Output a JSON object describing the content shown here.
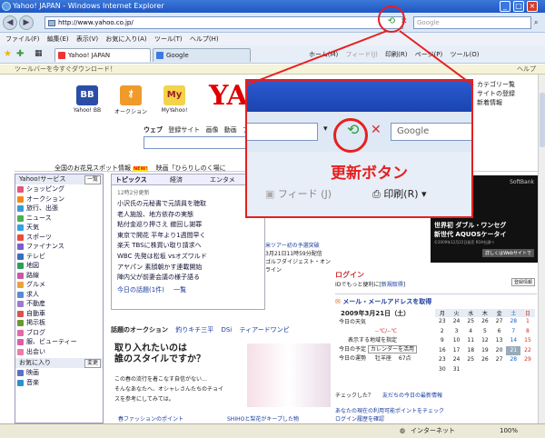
{
  "window": {
    "title": "Yahoo! JAPAN - Windows Internet Explorer"
  },
  "address": {
    "url": "http://www.yahoo.co.jp/",
    "search_placeholder": "Google"
  },
  "menu": [
    "ファイル(F)",
    "編集(E)",
    "表示(V)",
    "お気に入り(A)",
    "ツール(T)",
    "ヘルプ(H)"
  ],
  "tabs": [
    {
      "label": "Yahoo! JAPAN"
    },
    {
      "label": "Google"
    }
  ],
  "cmdbar": {
    "home": "ホーム(M)",
    "feed": "フィード(J)",
    "print": "印刷(R)",
    "page": "ページ(P)",
    "tools": "ツール(O)"
  },
  "infobar": {
    "text": "ツールバーを今すぐダウンロード！",
    "help": "ヘルプ"
  },
  "services": [
    {
      "label": "Yahoo! BB",
      "glyph": "BB"
    },
    {
      "label": "オークション",
      "glyph": "ｵ"
    },
    {
      "label": "MyYahoo!",
      "glyph": "My"
    }
  ],
  "logo": "YAH",
  "toprightlinks": [
    "カテゴリー覧",
    "サイトの登録",
    "新着情報"
  ],
  "searchtabs": [
    "ウェブ",
    "登録サイト",
    "画像",
    "動画",
    "ブ"
  ],
  "news_ticker": [
    "全国のお花見スポット情報",
    "映画「ひらりしのく場に"
  ],
  "sidebar": {
    "header": "Yahoo!サービス",
    "header_btn": "一覧",
    "items": [
      "ショッピング",
      "オークション",
      "旅行、出張",
      "ニュース",
      "天気",
      "スポーツ",
      "ファイナンス",
      "テレビ",
      "地図",
      "路線",
      "グルメ",
      "求人",
      "不動産",
      "自動車",
      "掲示板",
      "ブログ",
      "服、ビューティー",
      "出会い"
    ],
    "header2": "お気に入り",
    "header2_btn": "変更",
    "items2": [
      "映画",
      "音楽"
    ],
    "colors": [
      "#e4567a",
      "#f08a1c",
      "#3b9ad6",
      "#4caf50",
      "#37a1e0",
      "#e94b3c",
      "#7a5fc9",
      "#3b6bc1",
      "#2e9e5a",
      "#c85a9e",
      "#e8a33d",
      "#5b8bd0",
      "#9a7bd1",
      "#d9534f",
      "#6c9a2d",
      "#e36aa8",
      "#de5fa4",
      "#f07aa8",
      "#5c6fc8",
      "#2d8fd0"
    ]
  },
  "topics": {
    "tabs": [
      "トピックス",
      "経済",
      "エンタメ"
    ],
    "time": "12時2分更新",
    "items": [
      "小沢氏の元秘書で元請員を聴取",
      "老人施設、地方依存の実態",
      "粘付金巡り押さえ 撤回し謝罪",
      "東京で開花 平年より1週間早く",
      "楽天 TBSに株買い取り請求へ",
      "WBC 先発は松坂 vsオズワルド",
      "アヤパン 素顔朝かす連載開始",
      "陣内父が前妻会議の様子語る"
    ],
    "more": "今日の話題(1件)",
    "more2": "一覧"
  },
  "overlay": {
    "search": "Google",
    "feed": "フィード (J)",
    "print": "印刷(R)",
    "callout": "更新ボタン"
  },
  "ads": {
    "brand": "SoftBank",
    "line1": "世界初 ダブル・ワンセグ",
    "line2": "新世代 AQUOSケータイ",
    "line3": "©2009年12月22日発売 ROA社調べ",
    "btn": "詳しくはWebサイトで"
  },
  "center_mid": {
    "caption": "米ツアー初の予選突破",
    "caption2": "3月21日11時59分配信",
    "caption3": "ゴルフダイジェスト・オンライン"
  },
  "login": {
    "title": "ログイン",
    "sub": "IDでもっと便利に[",
    "new": "新規取得",
    "end": "]",
    "btn": "登録情報"
  },
  "mail": {
    "label": "メール・メールアドレスを取得"
  },
  "calendar": {
    "date": "2009年3月21日（土）",
    "weekdays": [
      "月",
      "火",
      "水",
      "木",
      "金",
      "土",
      "日"
    ],
    "rows": [
      [
        "23",
        "24",
        "25",
        "26",
        "27",
        "28",
        "1"
      ],
      [
        "2",
        "3",
        "4",
        "5",
        "6",
        "7",
        "8"
      ],
      [
        "9",
        "10",
        "11",
        "12",
        "13",
        "14",
        "15"
      ],
      [
        "16",
        "17",
        "18",
        "19",
        "20",
        "21",
        "22"
      ],
      [
        "23",
        "24",
        "25",
        "26",
        "27",
        "28",
        "29"
      ],
      [
        "30",
        "31",
        "",
        "",
        "",
        "",
        ""
      ]
    ]
  },
  "weather": {
    "title": "今日の天気",
    "temp": "--℃/--℃",
    "region": "表示する地域を指定",
    "plan": "今日の予定",
    "plan_btn": "カレンダーを活用",
    "fortune": "今日の運勢",
    "sign": "牡羊座",
    "points": "67点"
  },
  "topic_check": {
    "q": "チェックした？",
    "note": "友だちの今日の最新情報"
  },
  "auction": {
    "label": "話題のオークション",
    "items": [
      "釣りキチ三平",
      "DSi",
      "ティアードワンピ"
    ]
  },
  "fashion": {
    "title1": "取り入れたいのは",
    "title2": "誰のスタイルですか？",
    "body1": "この春の流行を着こなす自信がない…",
    "body2": "そんなあなたへ、オシャレさんたちのチョイ",
    "body3": "スを参考にしてみては。",
    "link1": "春ファッションのポイント",
    "link2": "SHIHOと梨花がキープした物"
  },
  "bottom_right": {
    "l1": "あなたの現在の利用可能ポイントをチェック",
    "l2": "ログイン履歴を確認"
  },
  "status": {
    "zone": "インターネット",
    "zoom": "100%"
  }
}
